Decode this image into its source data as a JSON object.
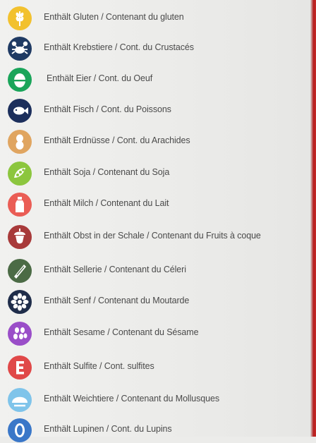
{
  "allergens": [
    {
      "label": "Enthält Gluten / Contenant du gluten",
      "icon": "wheat-icon",
      "color": "#f2c12e"
    },
    {
      "label": "Enthält Krebstiere / Cont. du Crustacés",
      "icon": "crab-icon",
      "color": "#1f3a63"
    },
    {
      "label": "Enthält Eier / Cont. du Oeuf",
      "icon": "egg-icon",
      "color": "#1aa55a"
    },
    {
      "label": "Enthält Fisch / Cont. du Poissons",
      "icon": "fish-icon",
      "color": "#1c2f5c"
    },
    {
      "label": "Enthält Erdnüsse / Cont. du Arachides",
      "icon": "peanut-icon",
      "color": "#e0a560"
    },
    {
      "label": "Enthält Soja / Contenant du Soja",
      "icon": "soy-icon",
      "color": "#8cc63e"
    },
    {
      "label": "Enthält Milch / Contenant du Lait",
      "icon": "milk-bottle-icon",
      "color": "#ea5d55"
    },
    {
      "label": "Enthält Obst in der Schale / Contenant du Fruits à coque",
      "icon": "nut-icon",
      "color": "#a83a3a"
    },
    {
      "label": "Enthält Sellerie / Contenant du Céleri",
      "icon": "celery-icon",
      "color": "#4b6b45"
    },
    {
      "label": "Enthält Senf / Contenant du Moutarde",
      "icon": "mustard-icon",
      "color": "#1f2d4a"
    },
    {
      "label": "Enthält Sesame / Contenant du Sésame",
      "icon": "sesame-icon",
      "color": "#9a4ec8"
    },
    {
      "label": "Enthält Sulfite / Cont. sulfites",
      "icon": "sulphite-e-icon",
      "color": "#e04848"
    },
    {
      "label": "Enthält Weichtiere / Contenant du Mollusques",
      "icon": "mollusc-icon",
      "color": "#7fc4ea"
    },
    {
      "label": "Enthält Lupinen / Cont. du Lupins",
      "icon": "lupin-icon",
      "color": "#3a77c8"
    }
  ]
}
